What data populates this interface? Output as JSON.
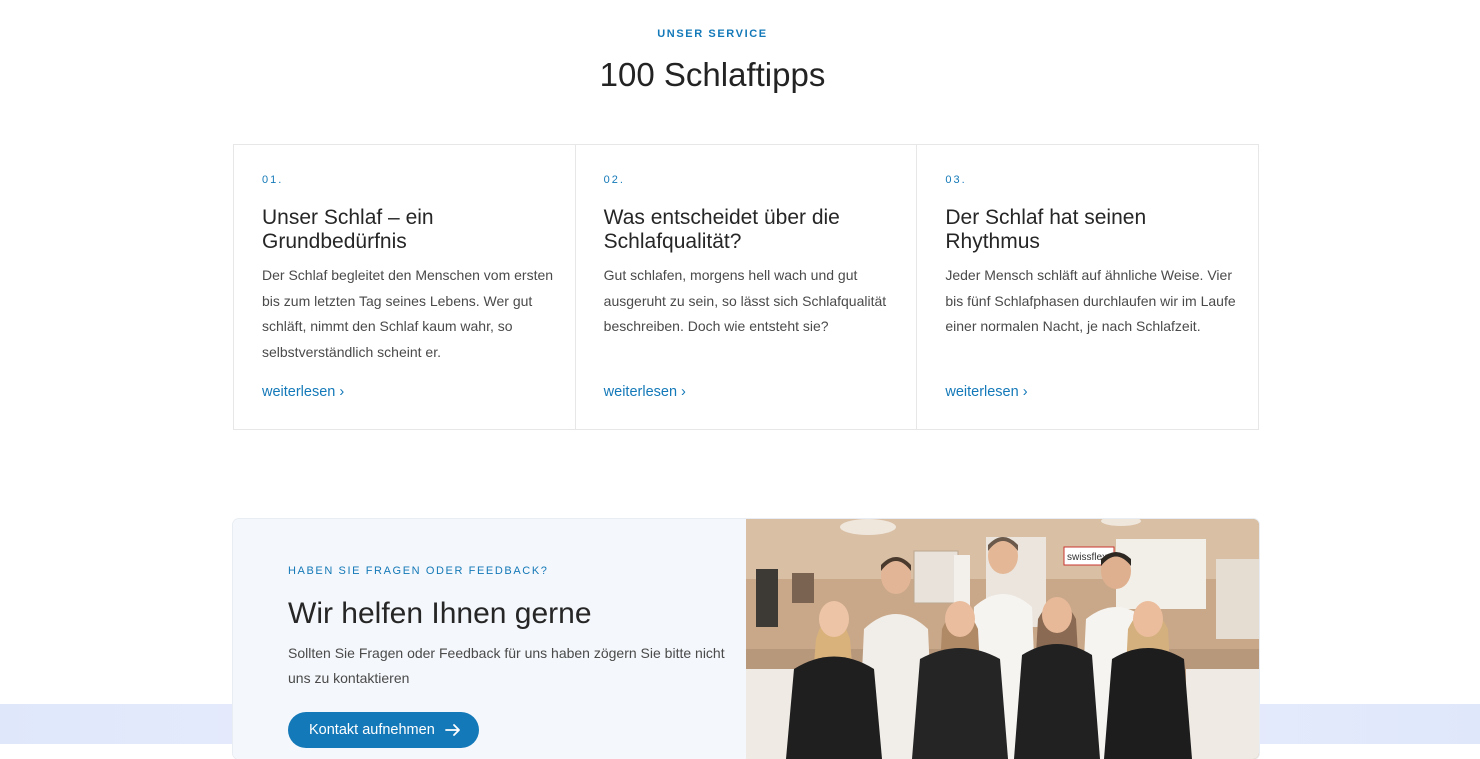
{
  "section": {
    "eyebrow": "UNSER SERVICE",
    "title": "100 Schlaftipps"
  },
  "cards": [
    {
      "num": "01.",
      "heading": "Unser Schlaf – ein Grundbedürfnis",
      "text": "Der Schlaf begleitet den Menschen vom ersten bis zum letzten Tag seines Lebens. Wer gut schläft, nimmt den Schlaf kaum wahr, so selbstverständlich scheint er.",
      "link": "weiterlesen ›"
    },
    {
      "num": "02.",
      "heading": "Was entscheidet über die Schlafqualität?",
      "text": "Gut schlafen, morgens hell wach und gut ausgeruht zu sein, so lässt sich Schlafqualität beschreiben. Doch wie entsteht sie?",
      "link": "weiterlesen ›"
    },
    {
      "num": "03.",
      "heading": "Der Schlaf hat seinen Rhythmus",
      "text": "Jeder Mensch schläft auf ähnliche Weise. Vier bis fünf Schlafphasen durchlaufen wir im Laufe einer normalen Nacht, je nach Schlafzeit.",
      "link": "weiterlesen ›"
    }
  ],
  "contact": {
    "eyebrow": "HABEN SIE FRAGEN ODER FEEDBACK?",
    "heading": "Wir helfen Ihnen gerne",
    "text": "Sollten Sie Fragen oder Feedback für uns haben zögern Sie bitte nicht uns zu kontaktieren",
    "button": "Kontakt aufnehmen",
    "photo_sign": "swissflex"
  },
  "colors": {
    "accent": "#1479b8",
    "text": "#2b2b2b"
  },
  "icons": {
    "button_icon": "arrow-right-icon"
  }
}
